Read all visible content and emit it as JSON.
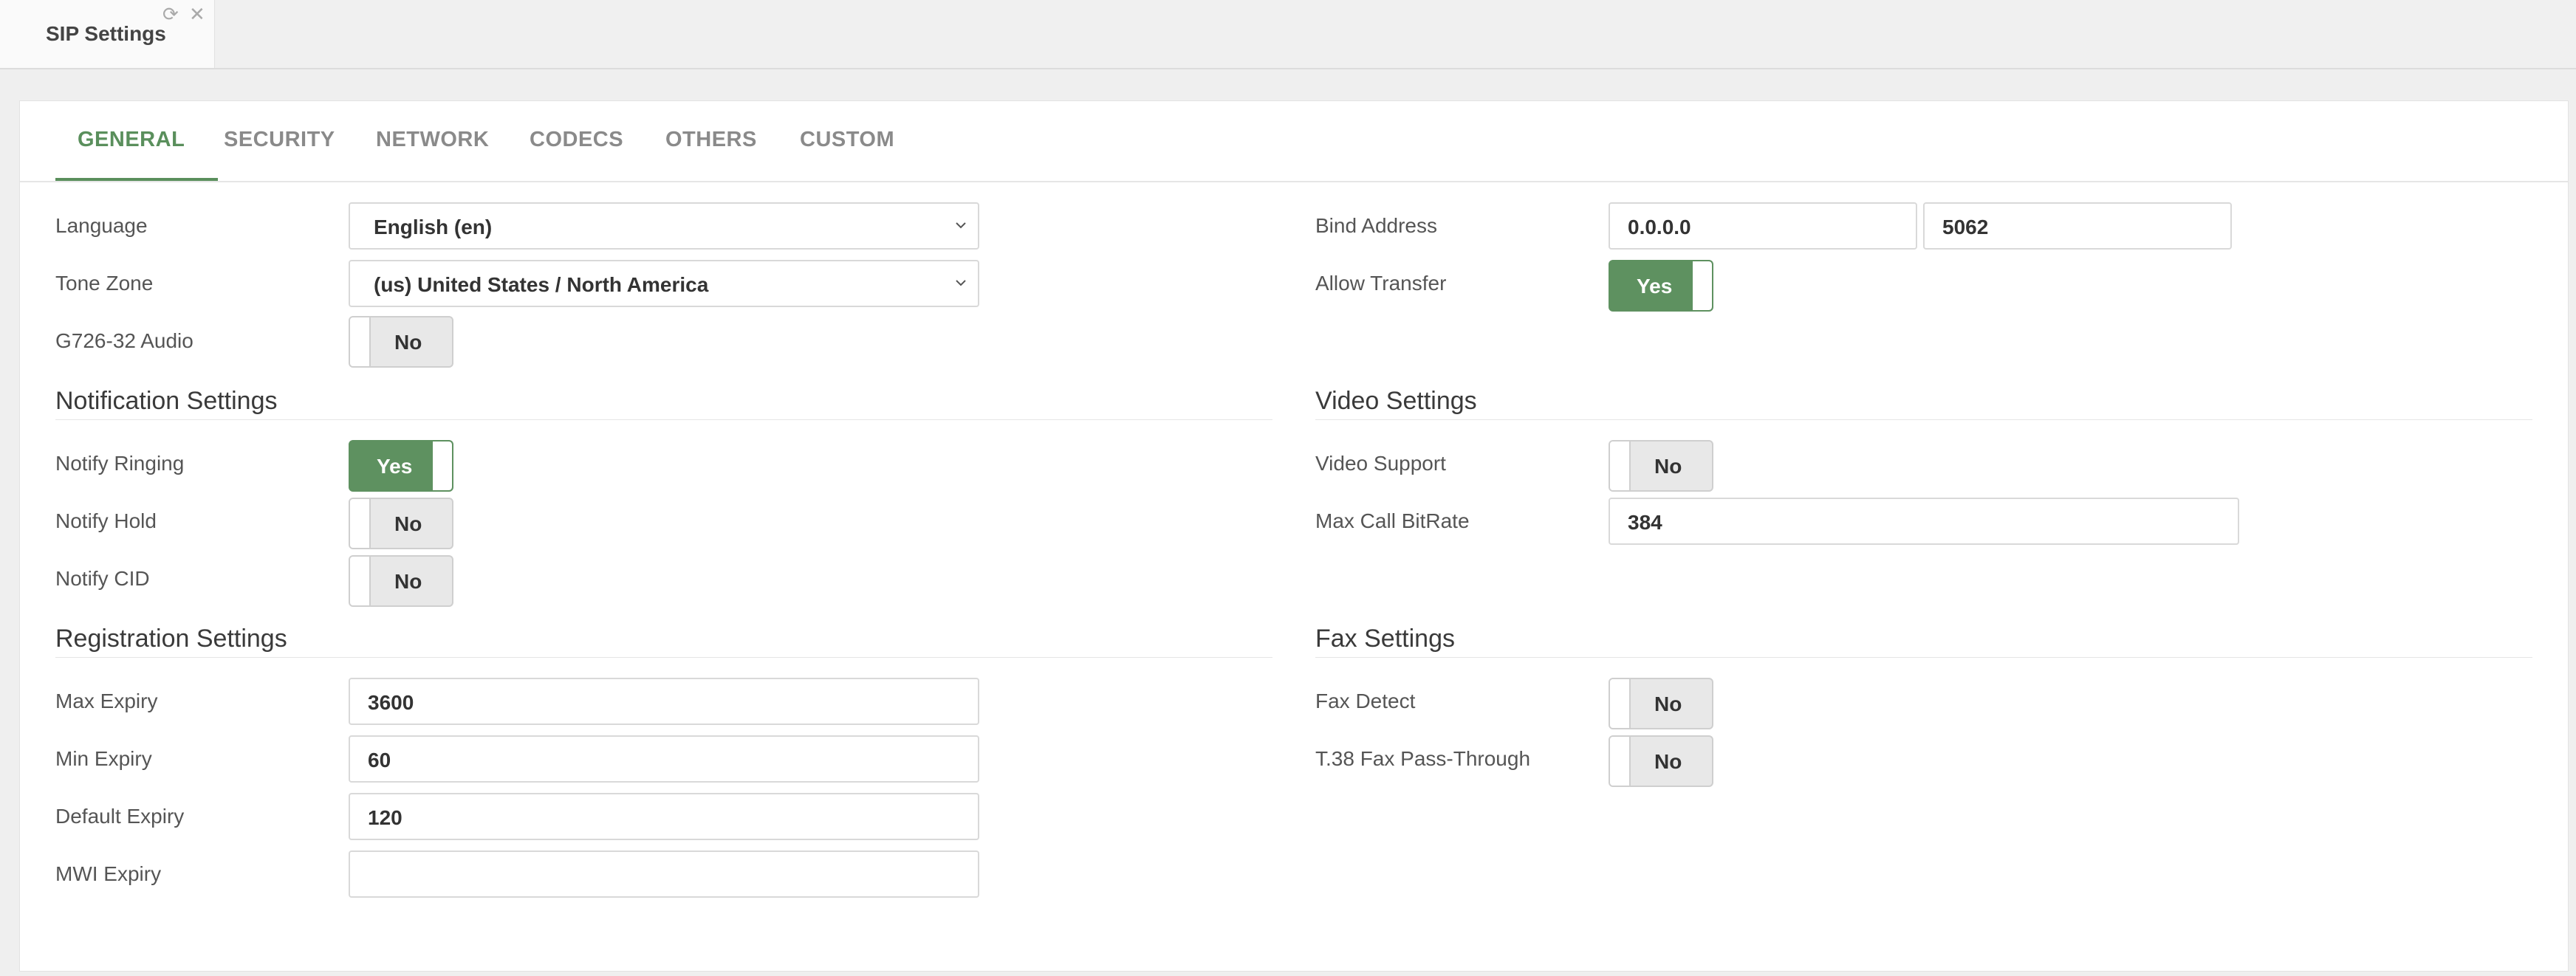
{
  "window_tab": {
    "title": "SIP Settings"
  },
  "tabs": [
    {
      "label": "GENERAL"
    },
    {
      "label": "SECURITY"
    },
    {
      "label": "NETWORK"
    },
    {
      "label": "CODECS"
    },
    {
      "label": "OTHERS"
    },
    {
      "label": "CUSTOM"
    }
  ],
  "general": {
    "language": {
      "label": "Language",
      "value": "English (en)"
    },
    "tone_zone": {
      "label": "Tone Zone",
      "value": "(us) United States / North America"
    },
    "g726": {
      "label": "G726-32 Audio",
      "value": "No"
    },
    "bind_address": {
      "label": "Bind Address",
      "ip": "0.0.0.0",
      "port": "5062"
    },
    "allow_transfer": {
      "label": "Allow Transfer",
      "value": "Yes"
    }
  },
  "notification": {
    "title": "Notification Settings",
    "ringing": {
      "label": "Notify Ringing",
      "value": "Yes"
    },
    "hold": {
      "label": "Notify Hold",
      "value": "No"
    },
    "cid": {
      "label": "Notify CID",
      "value": "No"
    }
  },
  "video": {
    "title": "Video Settings",
    "support": {
      "label": "Video Support",
      "value": "No"
    },
    "max_bitrate": {
      "label": "Max Call BitRate",
      "value": "384"
    }
  },
  "registration": {
    "title": "Registration Settings",
    "max_expiry": {
      "label": "Max Expiry",
      "value": "3600"
    },
    "min_expiry": {
      "label": "Min Expiry",
      "value": "60"
    },
    "default_expiry": {
      "label": "Default Expiry",
      "value": "120"
    },
    "mwi_expiry": {
      "label": "MWI Expiry",
      "value": ""
    }
  },
  "fax": {
    "title": "Fax Settings",
    "detect": {
      "label": "Fax Detect",
      "value": "No"
    },
    "t38": {
      "label": "T.38 Fax Pass-Through",
      "value": "No"
    }
  },
  "colors": {
    "accent": "#5e9160",
    "toggle_off": "#e8e8e8"
  }
}
